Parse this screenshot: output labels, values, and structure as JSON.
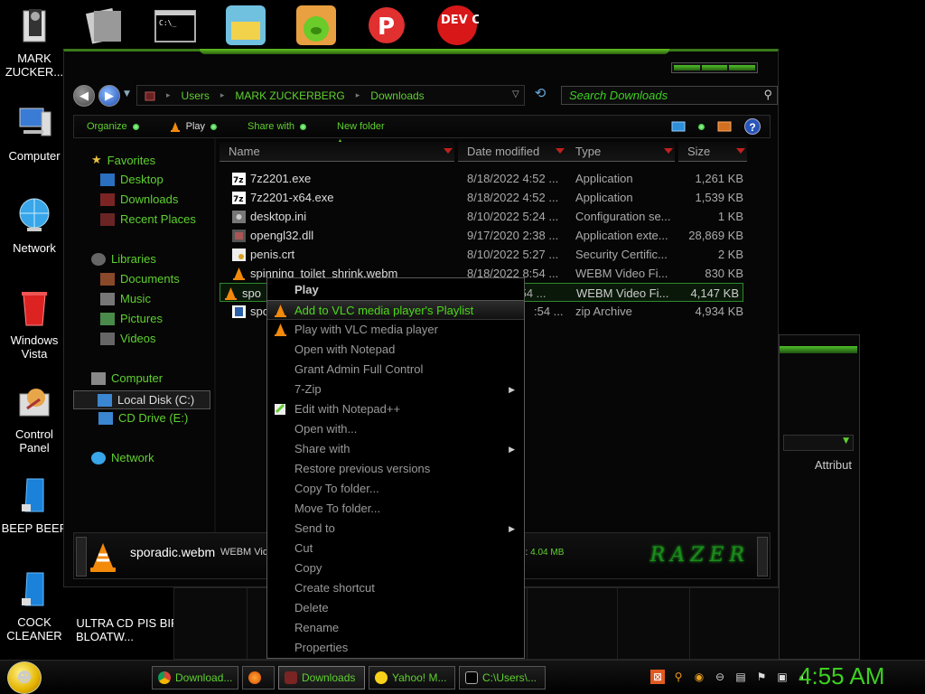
{
  "desktop": {
    "icons": [
      {
        "label": "MARK ZUCKER..."
      },
      {
        "label": "Computer"
      },
      {
        "label": "Network"
      },
      {
        "label": "Windows Vista"
      },
      {
        "label": "Control Panel"
      },
      {
        "label": "BEEP BEEP"
      },
      {
        "label": "COCK CLEANER"
      },
      {
        "label": "ULTRA CD BLOATW..."
      },
      {
        "label": "PIS BIRD"
      }
    ],
    "top_icons": [
      "DEV C++"
    ]
  },
  "explorer": {
    "breadcrumb": [
      "Users",
      "MARK ZUCKERBERG",
      "Downloads"
    ],
    "search_placeholder": "Search Downloads",
    "commands": [
      "Organize",
      "Play",
      "Share with",
      "New folder"
    ],
    "nav": {
      "favorites": "Favorites",
      "desktop": "Desktop",
      "downloads": "Downloads",
      "recent": "Recent Places",
      "libraries": "Libraries",
      "documents": "Documents",
      "music": "Music",
      "pictures": "Pictures",
      "videos": "Videos",
      "computer": "Computer",
      "local_disk": "Local Disk (C:)",
      "cd_drive": "CD Drive (E:)",
      "network": "Network"
    },
    "columns": [
      "Name",
      "Date modified",
      "Type",
      "Size"
    ],
    "files": [
      {
        "name": "7z2201.exe",
        "date": "8/18/2022 4:52 ...",
        "type": "Application",
        "size": "1,261 KB"
      },
      {
        "name": "7z2201-x64.exe",
        "date": "8/18/2022 4:52 ...",
        "type": "Application",
        "size": "1,539 KB"
      },
      {
        "name": "desktop.ini",
        "date": "8/10/2022 5:24 ...",
        "type": "Configuration se...",
        "size": "1 KB"
      },
      {
        "name": "opengl32.dll",
        "date": "9/17/2020 2:38 ...",
        "type": "Application exte...",
        "size": "28,869 KB"
      },
      {
        "name": "penis.crt",
        "date": "8/10/2022 5:27 ...",
        "type": "Security Certific...",
        "size": "2 KB"
      },
      {
        "name": "spinning_toilet_shrink.webm",
        "date": "8/18/2022 8:54 ...",
        "type": "WEBM Video Fi...",
        "size": "830 KB"
      },
      {
        "name": "spo",
        "date": ":54 ...",
        "type": "WEBM Video Fi...",
        "size": "4,147 KB"
      },
      {
        "name": "spo",
        "date": ":54 ...",
        "type": "zip Archive",
        "size": "4,934 KB"
      }
    ],
    "details": {
      "name": "sporadic.webm",
      "type": "WEBM Vide",
      "size_label": "e:",
      "size_value": "4.04 MB",
      "brand": "RAZER"
    }
  },
  "bg_window": {
    "attr_header": "Attribut"
  },
  "context_menu": {
    "items": [
      {
        "label": "Play"
      },
      {
        "label": "Add to VLC media player's Playlist"
      },
      {
        "label": "Play with VLC media player"
      },
      {
        "label": "Open with Notepad"
      },
      {
        "label": "Grant Admin Full Control"
      },
      {
        "label": "7-Zip"
      },
      {
        "label": "Edit with Notepad++"
      },
      {
        "label": "Open with..."
      },
      {
        "label": "Share with"
      },
      {
        "label": "Restore previous versions"
      },
      {
        "label": "Copy To folder..."
      },
      {
        "label": "Move To folder..."
      },
      {
        "label": "Send to"
      },
      {
        "label": "Cut"
      },
      {
        "label": "Copy"
      },
      {
        "label": "Create shortcut"
      },
      {
        "label": "Delete"
      },
      {
        "label": "Rename"
      },
      {
        "label": "Properties"
      }
    ]
  },
  "taskbar": {
    "tasks": [
      "Download...",
      "Downloads",
      "Yahoo! M...",
      "C:\\Users\\..."
    ],
    "clock": "4:55 AM"
  },
  "colors": {
    "accent": "#5fd030",
    "background": "#000000",
    "selection_border": "#2d8a2d"
  }
}
